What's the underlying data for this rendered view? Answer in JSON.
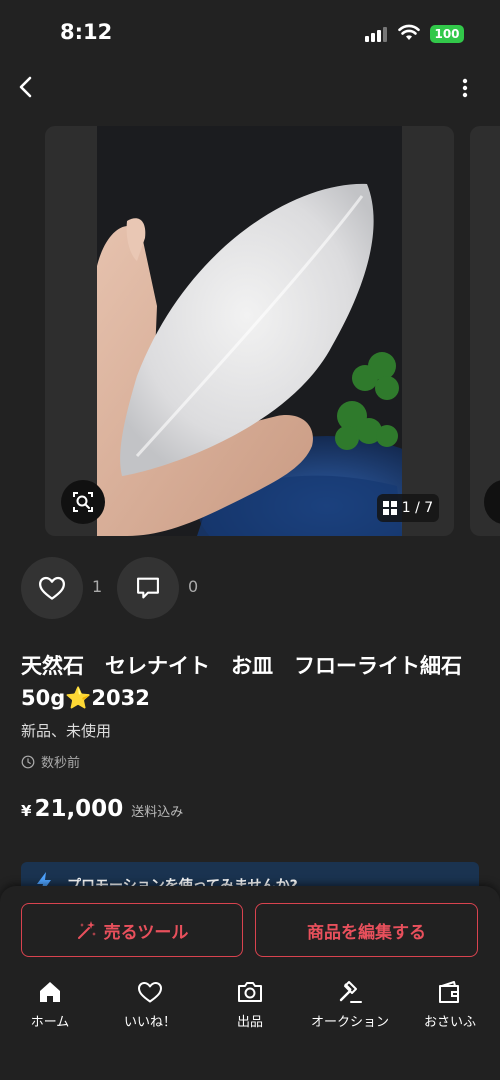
{
  "status_bar": {
    "time": "8:12",
    "battery": "100"
  },
  "gallery": {
    "counter": "1 / 7"
  },
  "actions": {
    "likes": "1",
    "comments": "0"
  },
  "item": {
    "title": "天然石　セレナイト　お皿　フローライト細石 50g⭐️2032",
    "condition": "新品、未使用",
    "posted": "数秒前",
    "currency": "¥",
    "price": "21,000",
    "shipping": "送料込み"
  },
  "promo": {
    "text": "プロモーションを使ってみませんか?"
  },
  "buttons": {
    "sell_tools": "売るツール",
    "edit_item": "商品を編集する"
  },
  "tabbar": [
    {
      "label": "ホーム",
      "icon": "home-icon"
    },
    {
      "label": "いいね！",
      "icon": "heart-icon"
    },
    {
      "label": "出品",
      "icon": "camera-icon"
    },
    {
      "label": "オークション",
      "icon": "gavel-icon"
    },
    {
      "label": "おさいふ",
      "icon": "wallet-icon"
    }
  ],
  "colors": {
    "accent": "#e8505c",
    "battery": "#32c84a",
    "background": "#222222"
  }
}
